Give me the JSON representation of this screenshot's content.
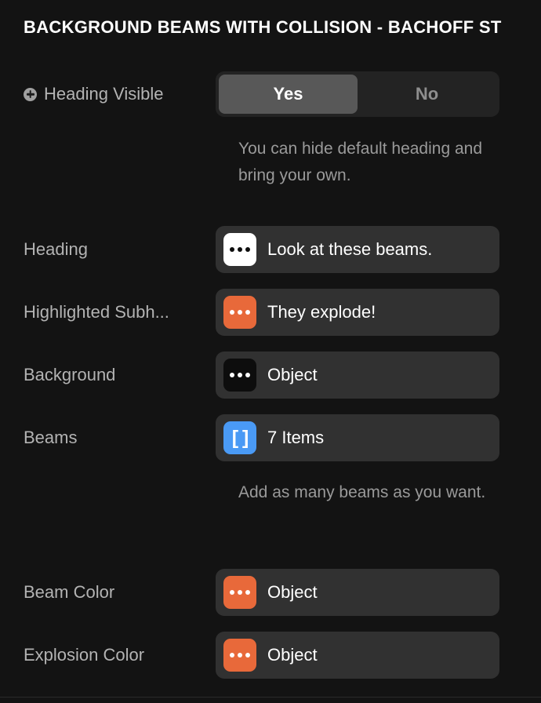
{
  "panel": {
    "title": "BACKGROUND BEAMS WITH COLLISION - BACHOFF ST",
    "background_color": "#131313"
  },
  "colors": {
    "accent_orange": "#e8693a",
    "accent_blue": "#4a9af5",
    "field_background": "#313131",
    "toggle_track": "#232323",
    "toggle_active": "#585858",
    "label_text": "#b3b3b3",
    "value_text": "#ffffff",
    "helper_text": "#9a9a9a"
  },
  "properties": [
    {
      "label": "Heading Visible",
      "has_add_icon": true,
      "control": "toggle",
      "options": [
        "Yes",
        "No"
      ],
      "selected": "Yes",
      "helper": "You can hide default heading and bring your own."
    },
    {
      "label": "Heading",
      "has_add_icon": false,
      "control": "field",
      "badge_style": "white",
      "badge_icon": "ellipsis-icon",
      "value": "Look at these beams.",
      "helper": ""
    },
    {
      "label": "Highlighted Subh...",
      "has_add_icon": false,
      "control": "field",
      "badge_style": "orange",
      "badge_icon": "ellipsis-icon",
      "value": "They explode!",
      "helper": ""
    },
    {
      "label": "Background",
      "has_add_icon": false,
      "control": "field",
      "badge_style": "black",
      "badge_icon": "ellipsis-icon",
      "value": "Object",
      "helper": ""
    },
    {
      "label": "Beams",
      "has_add_icon": false,
      "control": "field",
      "badge_style": "blue",
      "badge_icon": "brackets-icon",
      "badge_glyph": "[ ]",
      "value": "7 Items",
      "helper": "Add as many beams as you want."
    },
    {
      "label": "Beam Color",
      "has_add_icon": false,
      "control": "field",
      "badge_style": "orange",
      "badge_icon": "ellipsis-icon",
      "value": "Object",
      "helper": ""
    },
    {
      "label": "Explosion Color",
      "has_add_icon": false,
      "control": "field",
      "badge_style": "orange",
      "badge_icon": "ellipsis-icon",
      "value": "Object",
      "helper": ""
    }
  ]
}
